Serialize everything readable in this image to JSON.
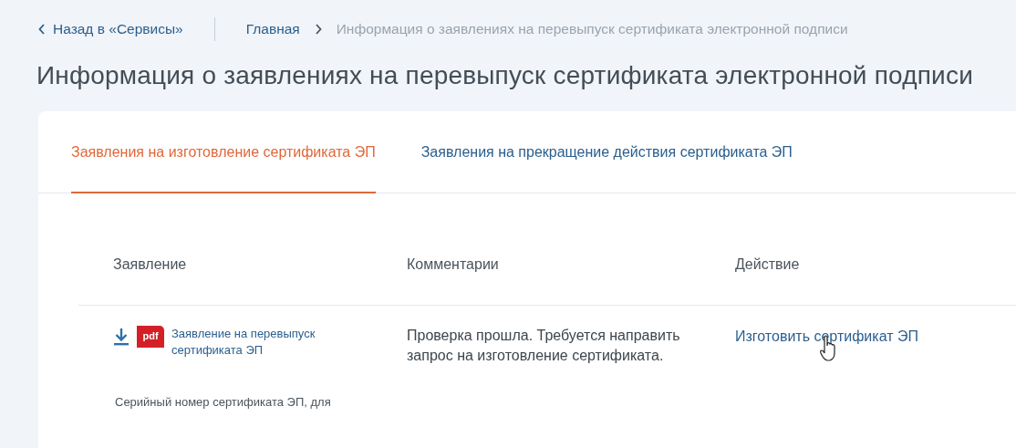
{
  "back_link": {
    "label": "Назад в «Сервисы»"
  },
  "breadcrumbs": [
    {
      "label": "Главная",
      "current": false
    },
    {
      "label": "Информация о заявлениях на перевыпуск сертификата электронной подписи",
      "current": true
    }
  ],
  "title": "Информация о заявлениях на перевыпуск сертификата электронной подписи",
  "tabs": [
    {
      "label": "Заявления на изготовление сертификата ЭП",
      "selected": true
    },
    {
      "label": "Заявления на прекращение действия сертификата ЭП",
      "selected": false
    }
  ],
  "table": {
    "columns": [
      "Заявление",
      "Комментарии",
      "Действие"
    ],
    "rows": [
      {
        "file_type": "pdf",
        "document": "Заявление на перевыпуск сертификата ЭП",
        "comment": "Проверка прошла. Требуется направить запрос на изготовление сертификата.",
        "action": "Изготовить сертификат ЭП"
      }
    ]
  },
  "footer_note": "Серийный номер сертификата ЭП, для"
}
